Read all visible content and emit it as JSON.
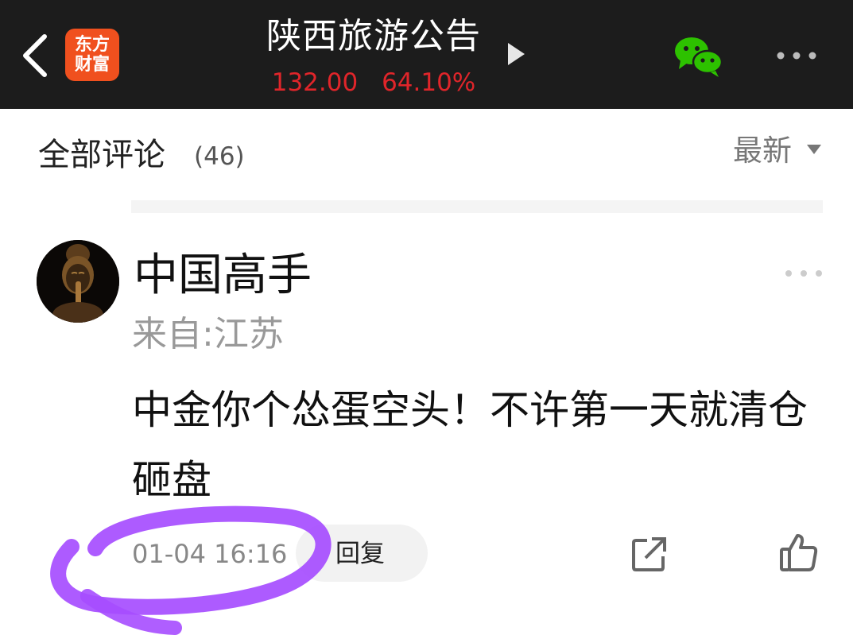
{
  "header": {
    "back_icon": "chevron-left-icon",
    "logo_line1": "东方",
    "logo_line2": "财富",
    "title": "陕西旅游公告",
    "price": "132.00",
    "change": "64.10%",
    "play_icon": "triangle-right-icon",
    "share_icon": "wechat-icon",
    "more_icon": "more-horizontal-icon"
  },
  "comments": {
    "header_label": "全部评论",
    "count": "(46)",
    "sort_label": "最新",
    "sort_icon": "caret-down-icon"
  },
  "post": {
    "username": "中国高手",
    "location": "来自:江苏",
    "content": "中金你个怂蛋空头！不许第一天就清仓砸盘",
    "time": "01-04 16:16",
    "reply_label": "回复",
    "share_icon": "share-external-icon",
    "like_icon": "thumbs-up-icon",
    "more_icon": "more-horizontal-icon"
  },
  "colors": {
    "topbar": "#1c1c1c",
    "price_red": "#e0252a",
    "logo_orange": "#f0501e",
    "wechat_green": "#2dc100",
    "annotation_purple": "#a64dff"
  }
}
